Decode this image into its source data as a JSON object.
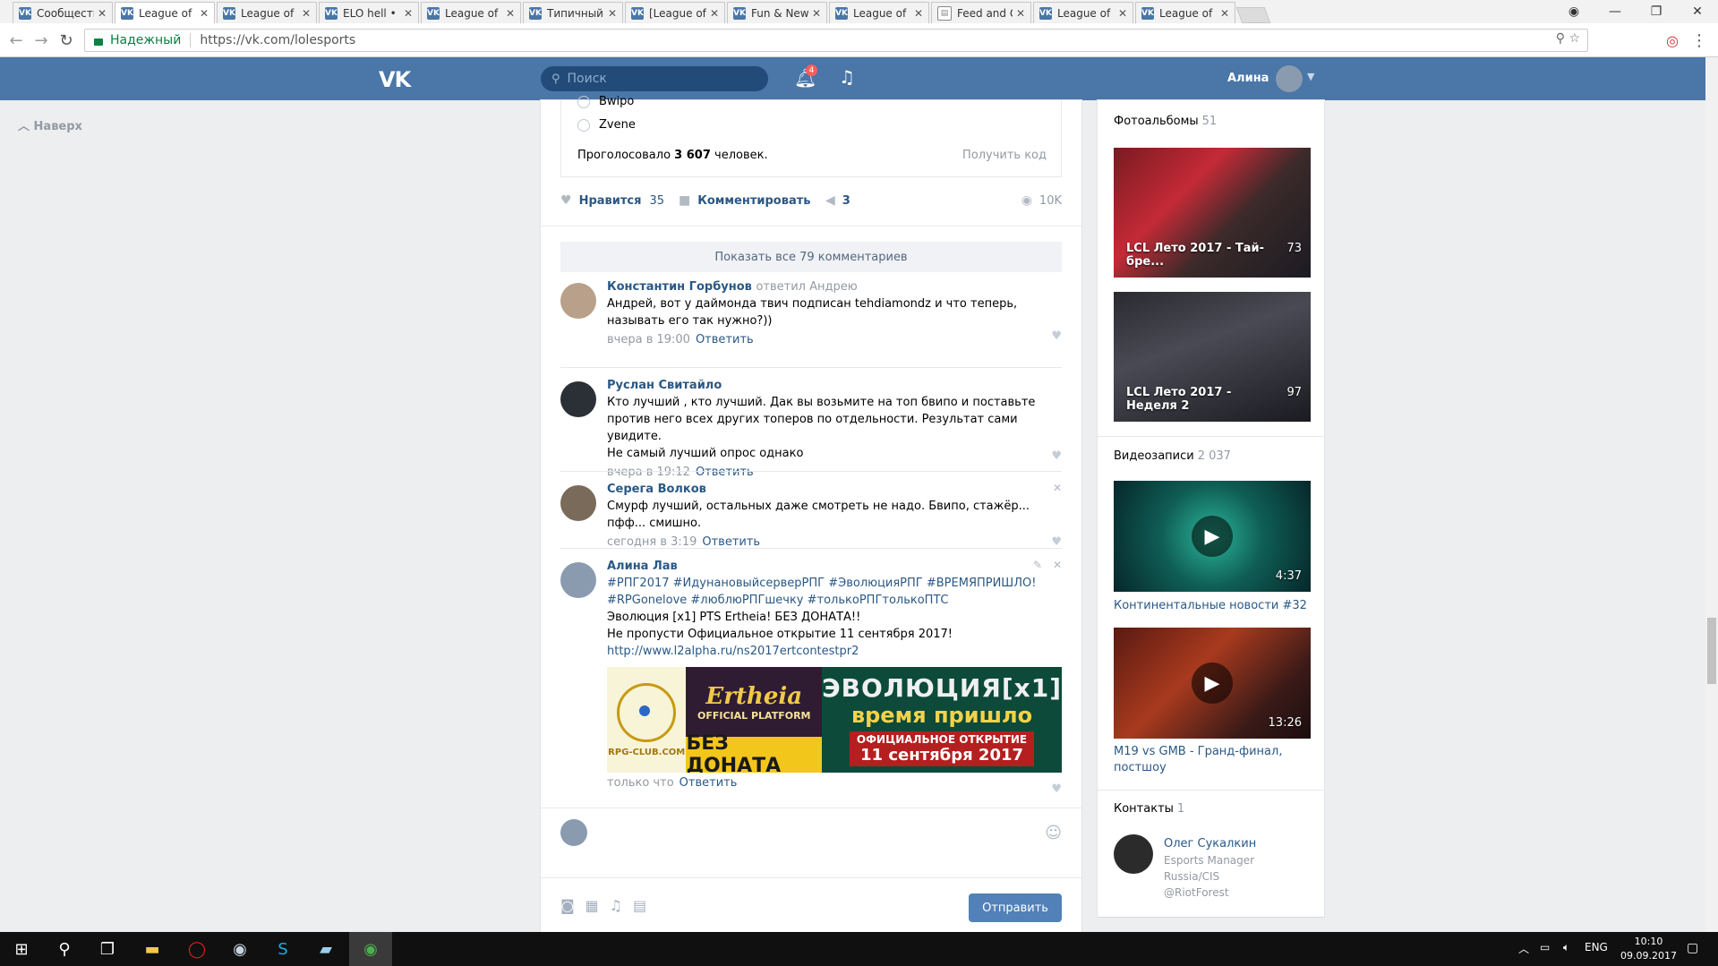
{
  "browser": {
    "tabs": [
      {
        "label": "Сообщества А",
        "icon": "vk-icon"
      },
      {
        "label": "League of Leg",
        "icon": "vk-icon",
        "active": true
      },
      {
        "label": "League of Leg",
        "icon": "vk-icon"
      },
      {
        "label": "ELO hell • Leag",
        "icon": "vk-icon"
      },
      {
        "label": "League of Leg",
        "icon": "vk-icon"
      },
      {
        "label": "Типичный Ло",
        "icon": "vk-icon"
      },
      {
        "label": "[League of Leg",
        "icon": "vk-icon"
      },
      {
        "label": "Fun & News o",
        "icon": "vk-icon"
      },
      {
        "label": "League of Leg",
        "icon": "vk-icon"
      },
      {
        "label": "Feed and Grea",
        "icon": "document-icon"
      },
      {
        "label": "League of Leg",
        "icon": "vk-icon"
      },
      {
        "label": "League of Leg",
        "icon": "vk-icon"
      }
    ],
    "secure_label": "Надежный",
    "url": "https://vk.com/lolesports"
  },
  "vk_header": {
    "logo": "VK",
    "search_placeholder": "Поиск",
    "notifications_count": "4",
    "user_name": "Алина"
  },
  "left": {
    "up_label": "Наверх"
  },
  "poll": {
    "options": [
      "Bwipo",
      "Zvene"
    ],
    "voted_prefix": "Проголосовало",
    "voted_count": "3 607",
    "voted_suffix": "человек.",
    "get_code": "Получить код"
  },
  "post_actions": {
    "like_label": "Нравится",
    "like_count": "35",
    "comment_label": "Комментировать",
    "share_count": "3",
    "views": "10K"
  },
  "show_all_comments": "Показать все 79 комментариев",
  "comments": [
    {
      "author": "Константин Горбунов",
      "reply_to": "ответил Андрею",
      "text": "Андрей, вот у даймонда твич подписан tehdiamondz и что теперь, называть его так нужно?))",
      "time": "вчера в 19:00",
      "reply": "Ответить"
    },
    {
      "author": "Руслан Свитайло",
      "text_lines": [
        "Кто лучший , кто лучший. Дак вы возьмите на топ бвипо и поставьте",
        "против него всех других топеров по отдельности. Результат сами увидите.",
        "Не самый лучший опрос однако"
      ],
      "time": "вчера в 19:12",
      "reply": "Ответить"
    },
    {
      "author": "Серега Волков",
      "text": "Смурф лучший, остальных даже смотреть не надо. Бвипо, стажёр... пфф... смишно.",
      "time": "сегодня в 3:19",
      "reply": "Ответить"
    },
    {
      "author": "Алина Лав",
      "tags_line1": "#РПГ2017 #ИдунановыйсерверРПГ #ЭволюцияРПГ #ВРЕМЯПРИШЛО!",
      "tags_line2": "#RPGonelove #люблюРПГшечку #толькоРПГтолькоПТС",
      "line3": "Эволюция [x1] PTS Ertheia! БЕЗ ДОНАТА!!",
      "line4": "Не пропусти Официальное открытие 11 сентября 2017!",
      "link": "http://www.l2alpha.ru/ns2017ertcontestpr2",
      "banner": {
        "rpg": "RPG-CLUB.COM",
        "ertheia": "Ertheia",
        "official": "OFFICIAL PLATFORM",
        "no_donate": "БЕЗ ДОНАТА",
        "evolution": "ЭВОЛЮЦИЯ[x1]",
        "time_came": "время пришло",
        "opening": "ОФИЦИАЛЬНОЕ ОТКРЫТИЕ",
        "date": "11 сентября 2017"
      },
      "time": "только что",
      "reply": "Ответить"
    }
  ],
  "composer": {
    "send_label": "Отправить"
  },
  "sidebar": {
    "albums_label": "Фотоальбомы",
    "albums_count": "51",
    "albums": [
      {
        "title": "LCL Лето 2017 - Тай-бре...",
        "count": "73"
      },
      {
        "title": "LCL Лето 2017 - Неделя 2",
        "count": "97"
      }
    ],
    "videos_label": "Видеозаписи",
    "videos_count": "2 037",
    "videos": [
      {
        "title": "Континентальные новости #32",
        "duration": "4:37"
      },
      {
        "title": "M19 vs GMB - Гранд-финал, постшоу",
        "duration": "13:26"
      }
    ],
    "contacts_label": "Контакты",
    "contacts_count": "1",
    "contact": {
      "name": "Олег Сукалкин",
      "role": "Esports Manager",
      "region": "Russia/CIS",
      "handle": "@RiotForest"
    }
  },
  "taskbar": {
    "lang": "ENG",
    "time": "10:10",
    "date": "09.09.2017"
  },
  "colors": {
    "vk_blue": "#4a76a8",
    "link": "#2a5885",
    "muted": "#939aa3",
    "send_button": "#5181b8"
  }
}
